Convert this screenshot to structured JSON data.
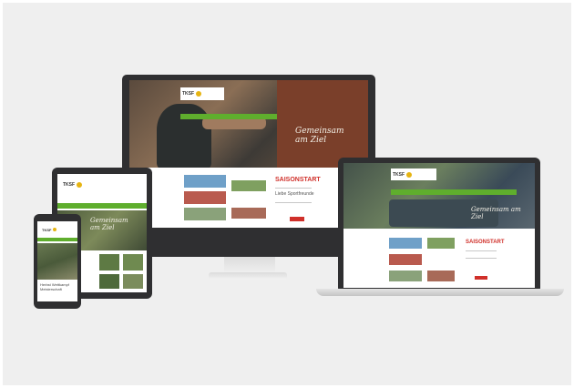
{
  "colors": {
    "background": "#efefef",
    "device_frame": "#2f2f31",
    "nav_green": "#5fae2d",
    "accent_red": "#d0302a",
    "logo_yellow": "#e6b412"
  },
  "site": {
    "logo_text": "TKSF",
    "hero_script": "Gemeinsam am Ziel",
    "headline": "SAISONSTART",
    "subline": "Liebe Sportfreunde",
    "mobile_caption": "Herbst Wettkampf Meisterschaft"
  },
  "devices": [
    "desktop-monitor",
    "tablet",
    "smartphone",
    "laptop"
  ]
}
